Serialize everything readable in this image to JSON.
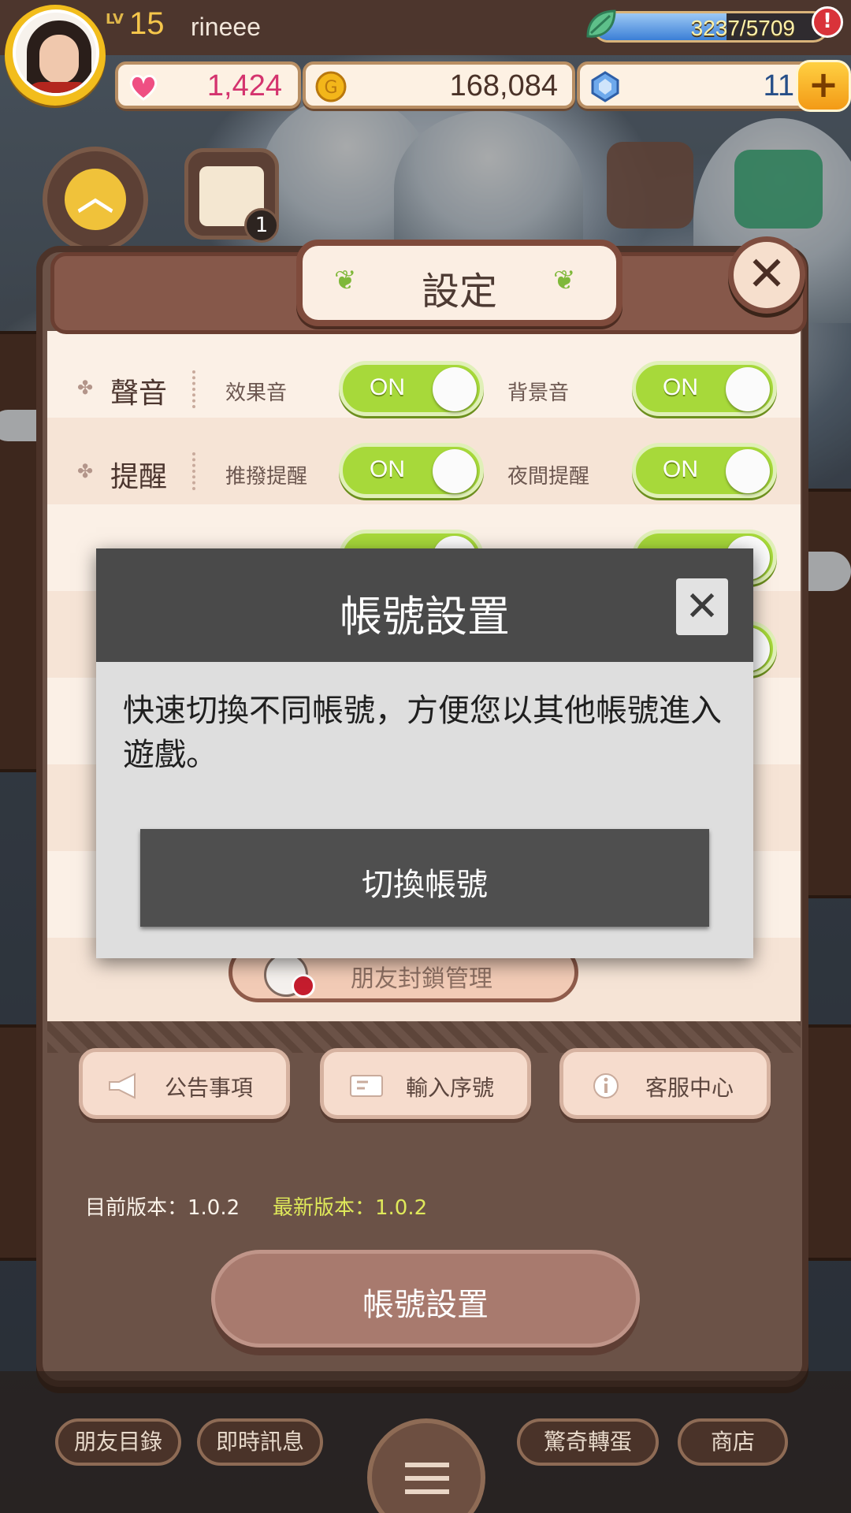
{
  "hud": {
    "level_label": "LV",
    "level": "15",
    "username": "rineee",
    "energy": {
      "text": "3237/5709",
      "fraction": 0.567
    },
    "alert_badge": "!",
    "hearts": "1,424",
    "gold": "168,084",
    "gems": "11",
    "plus_label": "+",
    "calendar_badge": "1"
  },
  "settings": {
    "title": "設定",
    "close_label": "✕",
    "rows": [
      {
        "label": "聲音",
        "options": [
          {
            "label": "效果音",
            "state": "ON"
          },
          {
            "label": "背景音",
            "state": "ON"
          }
        ]
      },
      {
        "label": "提醒",
        "options": [
          {
            "label": "推撥提醒",
            "state": "ON"
          },
          {
            "label": "夜間提醒",
            "state": "ON"
          }
        ]
      }
    ],
    "friend_block_label": "朋友封鎖管理",
    "buttons": {
      "announcements": "公告事項",
      "serial": "輸入序號",
      "support": "客服中心"
    },
    "current_version": "目前版本：1.0.2",
    "latest_version": "最新版本：1.0.2",
    "account_button": "帳號設置"
  },
  "dialog": {
    "title": "帳號設置",
    "close_label": "✕",
    "body": "快速切換不同帳號，方便您以其他帳號進入遊戲。",
    "button": "切換帳號"
  },
  "bottom_nav": {
    "friends": "朋友目錄",
    "messages": "即時訊息",
    "gacha": "驚奇轉蛋",
    "shop": "商店"
  },
  "colors": {
    "toggle_on": "#a7d93a",
    "panel_bg": "#6b5247",
    "dialog_header": "#4a4a4a",
    "latest_version": "#dfe95a"
  }
}
